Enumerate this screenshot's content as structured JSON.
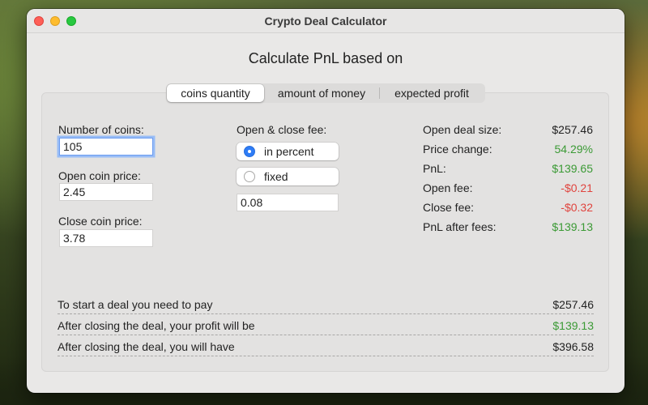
{
  "window": {
    "title": "Crypto Deal Calculator"
  },
  "heading": "Calculate PnL based on",
  "tabs": [
    {
      "label": "coins quantity",
      "selected": true
    },
    {
      "label": "amount of money",
      "selected": false
    },
    {
      "label": "expected profit",
      "selected": false
    }
  ],
  "inputs": {
    "coins_label": "Number of coins:",
    "coins_value": "105",
    "open_price_label": "Open coin price:",
    "open_price_value": "2.45",
    "close_price_label": "Close coin price:",
    "close_price_value": "3.78"
  },
  "fee": {
    "label": "Open & close fee:",
    "options": [
      {
        "label": "in percent",
        "selected": true
      },
      {
        "label": "fixed",
        "selected": false
      }
    ],
    "value": "0.08"
  },
  "stats": [
    {
      "label": "Open deal size:",
      "value": "$257.46",
      "tone": "neutral"
    },
    {
      "label": "Price change:",
      "value": "54.29%",
      "tone": "pos"
    },
    {
      "label": "PnL:",
      "value": "$139.65",
      "tone": "pos"
    },
    {
      "label": "Open fee:",
      "value": "-$0.21",
      "tone": "neg"
    },
    {
      "label": "Close fee:",
      "value": "-$0.32",
      "tone": "neg"
    },
    {
      "label": "PnL after fees:",
      "value": "$139.13",
      "tone": "pos"
    }
  ],
  "summary": [
    {
      "label": "To start a deal you need to pay",
      "value": "$257.46",
      "tone": "neutral"
    },
    {
      "label": "After closing the deal, your profit will be",
      "value": "$139.13",
      "tone": "pos"
    },
    {
      "label": "After closing the deal, you will have",
      "value": "$396.58",
      "tone": "neutral"
    }
  ],
  "colors": {
    "positive": "#3b9a35",
    "negative": "#e0443e",
    "accent": "#2e7cf6"
  }
}
